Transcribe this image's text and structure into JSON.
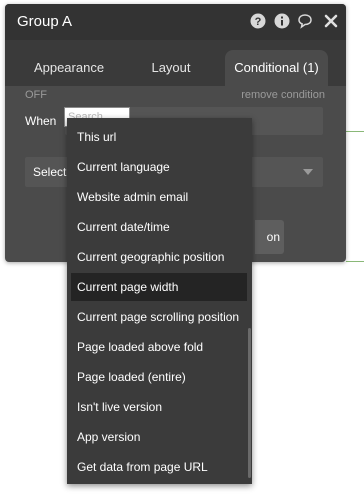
{
  "panel": {
    "title": "Group A",
    "header_icons": [
      "help-icon",
      "info-icon",
      "comment-icon",
      "close-icon"
    ]
  },
  "tabs": [
    {
      "label": "Appearance",
      "active": false
    },
    {
      "label": "Layout",
      "active": false
    },
    {
      "label": "Conditional (1)",
      "active": true
    }
  ],
  "condition": {
    "status": "OFF",
    "remove_label": "remove condition",
    "when_label": "When",
    "search_placeholder": "Search...",
    "select_label": "Select",
    "action_label": "on"
  },
  "dropdown": {
    "items": [
      "This url",
      "Current language",
      "Website admin email",
      "Current date/time",
      "Current geographic position",
      "Current page width",
      "Current page scrolling position",
      "Page loaded above fold",
      "Page loaded (entire)",
      "Isn't live version",
      "App version",
      "Get data from page URL"
    ],
    "highlighted_index": 5
  },
  "colors": {
    "panel_bg": "#4b4b4b",
    "header_bg": "#333333",
    "dropdown_bg": "#3b3b3b",
    "highlight_bg": "#242424"
  }
}
